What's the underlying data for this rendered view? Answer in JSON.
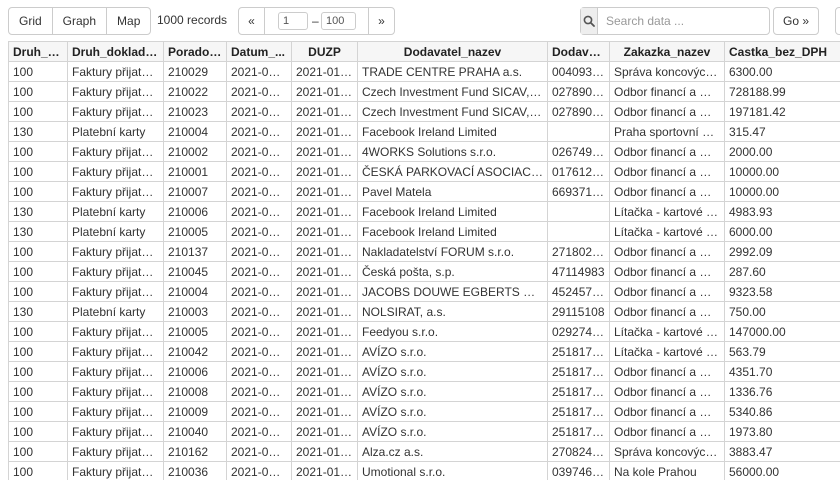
{
  "toolbar": {
    "views": [
      "Grid",
      "Graph",
      "Map"
    ],
    "record_count": "1000 records",
    "pager": {
      "prev": "«",
      "from": "1",
      "dash": "–",
      "to": "100",
      "next": "»"
    },
    "search": {
      "placeholder": "Search data ...",
      "value": ""
    },
    "go_label": "Go »"
  },
  "table": {
    "columns": [
      "Druh_d...",
      "Druh_dokladu...",
      "Poradov...",
      "Datum_...",
      "DUZP",
      "Dodavatel_nazev",
      "Dodavat...",
      "Zakazka_nazev",
      "Castka_bez_DPH"
    ],
    "rows": [
      [
        "100",
        "Faktury přijaté t...",
        "210029",
        "2021-01-...",
        "2021-01-...",
        "TRADE CENTRE PRAHA a.s.",
        "00409316",
        "Správa koncových ...",
        "6300.00"
      ],
      [
        "100",
        "Faktury přijaté t...",
        "210022",
        "2021-01-...",
        "2021-01-...",
        "Czech Investment Fund SICAV, a.s.",
        "02789027",
        "Odbor financí a HR...",
        "728188.99"
      ],
      [
        "100",
        "Faktury přijaté t...",
        "210023",
        "2021-01-...",
        "2021-01-...",
        "Czech Investment Fund SICAV, a.s.",
        "02789027",
        "Odbor financí a HR...",
        "197181.42"
      ],
      [
        "130",
        "Platební karty",
        "210004",
        "2021-01-...",
        "2021-01-...",
        "Facebook Ireland Limited",
        "",
        "Praha sportovní a ...",
        "315.47"
      ],
      [
        "100",
        "Faktury přijaté t...",
        "210002",
        "2021-01-...",
        "2021-01-...",
        "4WORKS Solutions s.r.o.",
        "02674947",
        "Odbor financí a HR...",
        "2000.00"
      ],
      [
        "100",
        "Faktury přijaté t...",
        "210001",
        "2021-01-...",
        "2021-01-...",
        "ČESKÁ PARKOVACÍ ASOCIACE z...",
        "01761226",
        "Odbor financí a HR...",
        "10000.00"
      ],
      [
        "100",
        "Faktury přijaté t...",
        "210007",
        "2021-01-...",
        "2021-01-...",
        "Pavel Matela",
        "66937132",
        "Odbor financí a HR...",
        "10000.00"
      ],
      [
        "130",
        "Platební karty",
        "210006",
        "2021-01-...",
        "2021-01-...",
        "Facebook Ireland Limited",
        "",
        "Lítačka - kartové ce...",
        "4983.93"
      ],
      [
        "130",
        "Platební karty",
        "210005",
        "2021-01-...",
        "2021-01-...",
        "Facebook Ireland Limited",
        "",
        "Lítačka - kartové ce...",
        "6000.00"
      ],
      [
        "100",
        "Faktury přijaté t...",
        "210137",
        "2021-01-...",
        "2021-01-...",
        "Nakladatelství FORUM s.r.o.",
        "27180271",
        "Odbor financí a HR...",
        "2992.09"
      ],
      [
        "100",
        "Faktury přijaté t...",
        "210045",
        "2021-01-...",
        "2021-01-...",
        "Česká pošta, s.p.",
        "47114983",
        "Odbor financí a HR...",
        "287.60"
      ],
      [
        "100",
        "Faktury přijaté t...",
        "210004",
        "2021-01-11",
        "2021-01-...",
        "JACOBS DOUWE EGBERTS CZ s...",
        "45245738",
        "Odbor financí a HR...",
        "9323.58"
      ],
      [
        "130",
        "Platební karty",
        "210003",
        "2021-01-...",
        "2021-01-...",
        "NOLSIRAT, a.s.",
        "29115108",
        "Odbor financí a HR...",
        "750.00"
      ],
      [
        "100",
        "Faktury přijaté t...",
        "210005",
        "2021-01-...",
        "2021-01-...",
        "Feedyou s.r.o.",
        "02927438",
        "Lítačka - kartové ce...",
        "147000.00"
      ],
      [
        "100",
        "Faktury přijaté t...",
        "210042",
        "2021-01-...",
        "2021-01-...",
        "AVÍZO s.r.o.",
        "25181700",
        "Lítačka - kartové ce...",
        "563.79"
      ],
      [
        "100",
        "Faktury přijaté t...",
        "210006",
        "2021-01-...",
        "2021-01-...",
        "AVÍZO s.r.o.",
        "25181700",
        "Odbor financí a HR...",
        "4351.70"
      ],
      [
        "100",
        "Faktury přijaté t...",
        "210008",
        "2021-01-...",
        "2021-01-...",
        "AVÍZO s.r.o.",
        "25181700",
        "Odbor financí a HR...",
        "1336.76"
      ],
      [
        "100",
        "Faktury přijaté t...",
        "210009",
        "2021-01-...",
        "2021-01-...",
        "AVÍZO s.r.o.",
        "25181700",
        "Odbor financí a HR...",
        "5340.86"
      ],
      [
        "100",
        "Faktury přijaté t...",
        "210040",
        "2021-01-...",
        "2021-01-...",
        "AVÍZO s.r.o.",
        "25181700",
        "Odbor financí a HR...",
        "1973.80"
      ],
      [
        "100",
        "Faktury přijaté t...",
        "210162",
        "2021-01-...",
        "2021-01-...",
        "Alza.cz a.s.",
        "27082440",
        "Správa koncových ...",
        "3883.47"
      ],
      [
        "100",
        "Faktury přijaté t...",
        "210036",
        "2021-01-...",
        "2021-01-...",
        "Umotional s.r.o.",
        "03974618",
        "Na kole Prahou",
        "56000.00"
      ]
    ]
  }
}
